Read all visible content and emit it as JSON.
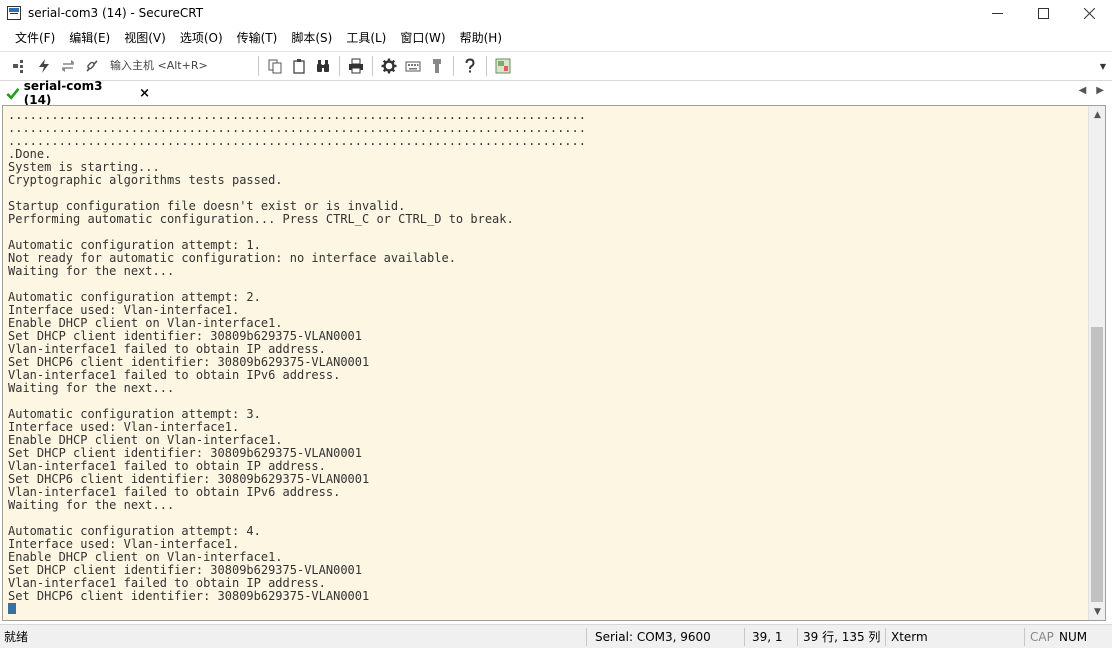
{
  "window": {
    "title": "serial-com3 (14) - SecureCRT",
    "controls": {
      "minimize": "—",
      "maximize": "☐",
      "close": "✕"
    }
  },
  "menu": {
    "items": [
      "文件(F)",
      "编辑(E)",
      "视图(V)",
      "选项(O)",
      "传输(T)",
      "脚本(S)",
      "工具(L)",
      "窗口(W)",
      "帮助(H)"
    ]
  },
  "toolbar": {
    "host_placeholder": "输入主机 <Alt+R>",
    "icons_left": [
      "connect-bar-icon",
      "quick-connect-icon",
      "reconnect-icon",
      "disconnect-icon"
    ],
    "icons_right": [
      "copy-icon",
      "paste-icon",
      "find-icon",
      "print-icon",
      "settings-icon",
      "keymap-icon",
      "sftp-icon",
      "help-icon",
      "screen-icon"
    ]
  },
  "tab": {
    "label": "serial-com3 (14)",
    "close": "×",
    "status_color": "#1e9e1e"
  },
  "terminal": {
    "background": "#fdf6e3",
    "lines": [
      "................................................................................",
      "................................................................................",
      "................................................................................",
      ".Done.",
      "System is starting...",
      "Cryptographic algorithms tests passed.",
      "",
      "Startup configuration file doesn't exist or is invalid.",
      "Performing automatic configuration... Press CTRL_C or CTRL_D to break.",
      "",
      "Automatic configuration attempt: 1.",
      "Not ready for automatic configuration: no interface available.",
      "Waiting for the next...",
      "",
      "Automatic configuration attempt: 2.",
      "Interface used: Vlan-interface1.",
      "Enable DHCP client on Vlan-interface1.",
      "Set DHCP client identifier: 30809b629375-VLAN0001",
      "Vlan-interface1 failed to obtain IP address.",
      "Set DHCP6 client identifier: 30809b629375-VLAN0001",
      "Vlan-interface1 failed to obtain IPv6 address.",
      "Waiting for the next...",
      "",
      "Automatic configuration attempt: 3.",
      "Interface used: Vlan-interface1.",
      "Enable DHCP client on Vlan-interface1.",
      "Set DHCP client identifier: 30809b629375-VLAN0001",
      "Vlan-interface1 failed to obtain IP address.",
      "Set DHCP6 client identifier: 30809b629375-VLAN0001",
      "Vlan-interface1 failed to obtain IPv6 address.",
      "Waiting for the next...",
      "",
      "Automatic configuration attempt: 4.",
      "Interface used: Vlan-interface1.",
      "Enable DHCP client on Vlan-interface1.",
      "Set DHCP client identifier: 30809b629375-VLAN0001",
      "Vlan-interface1 failed to obtain IP address.",
      "Set DHCP6 client identifier: 30809b629375-VLAN0001"
    ],
    "cursor_color": "#3a6ea5"
  },
  "status": {
    "ready": "就绪",
    "connection": "Serial: COM3, 9600",
    "cursor_pos": "39,   1",
    "size": "39 行, 135 列",
    "emulation": "Xterm",
    "cap": "CAP",
    "num": "NUM"
  }
}
